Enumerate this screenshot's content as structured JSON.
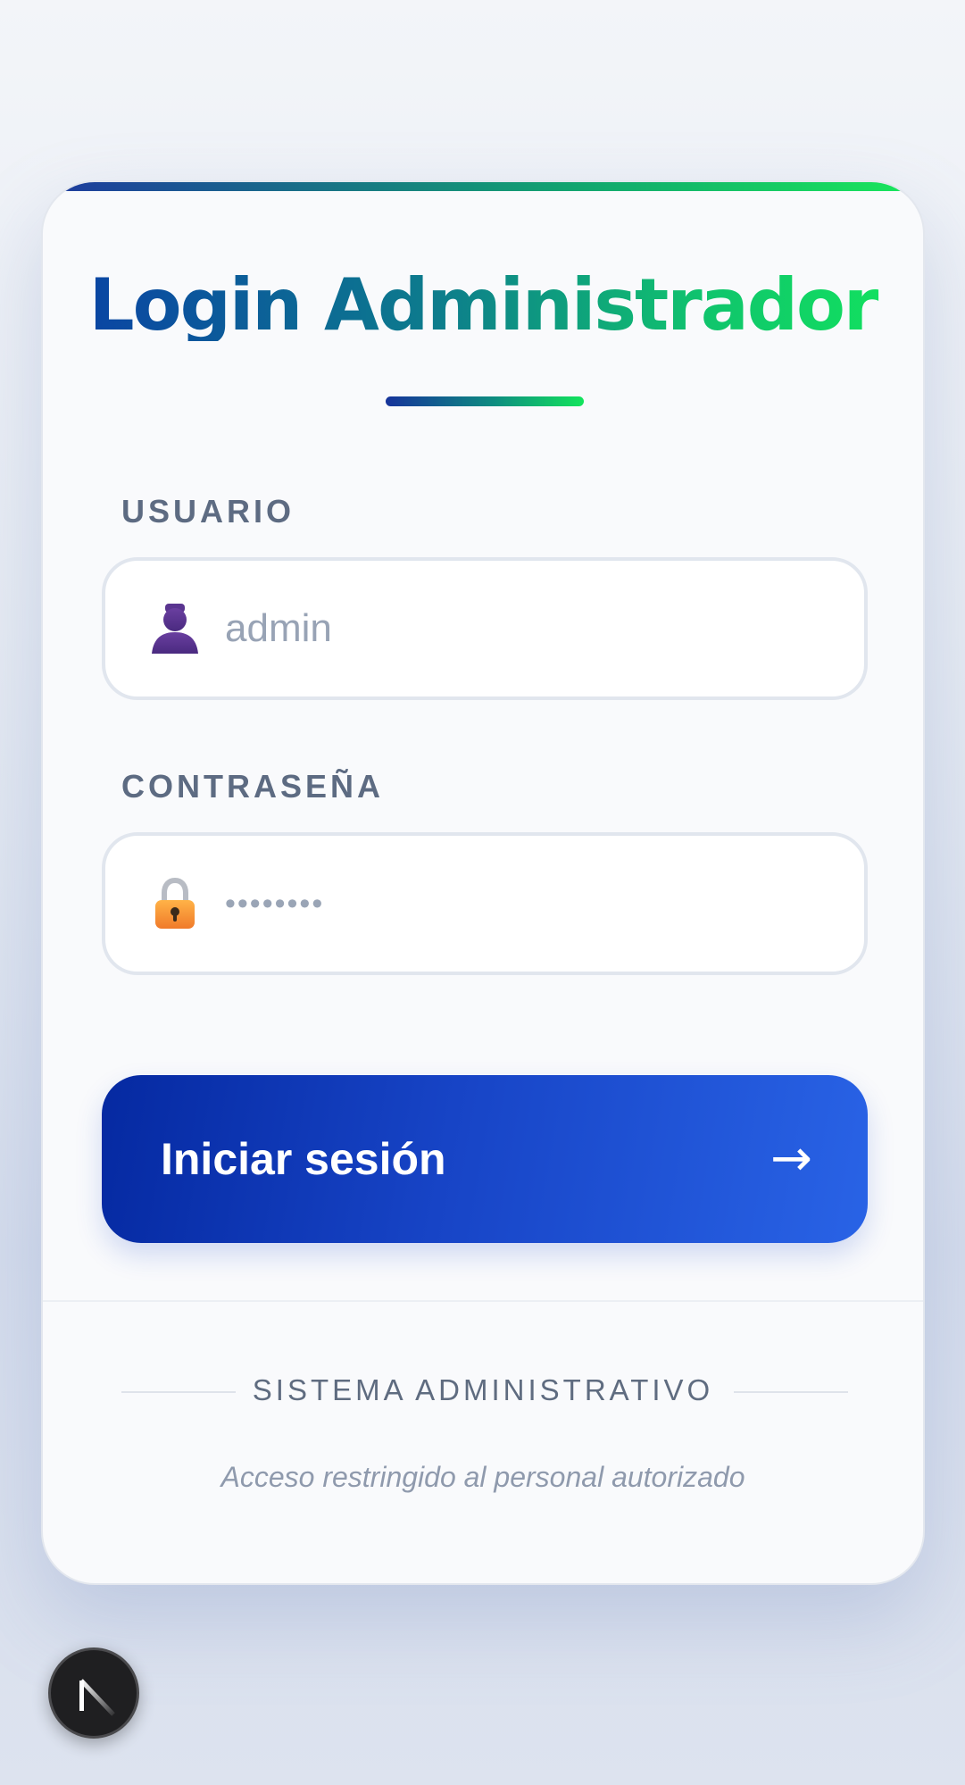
{
  "login": {
    "title": "Login Administrador",
    "username_label": "USUARIO",
    "username_value": "admin",
    "password_label": "CONTRASEÑA",
    "password_value": "••••••••",
    "submit_label": "Iniciar sesión",
    "submit_icon": "→"
  },
  "footer": {
    "system_label": "SISTEMA ADMINISTRATIVO",
    "note": "Acceso restringido al personal autorizado"
  },
  "icons": {
    "username_icon": "user-icon",
    "password_icon": "lock-icon",
    "badge_icon": "nextjs-icon"
  },
  "colors": {
    "button_start": "#0529a1",
    "button_end": "#2963e6",
    "title_start": "#0a3ea6",
    "title_end": "#12e65c"
  }
}
